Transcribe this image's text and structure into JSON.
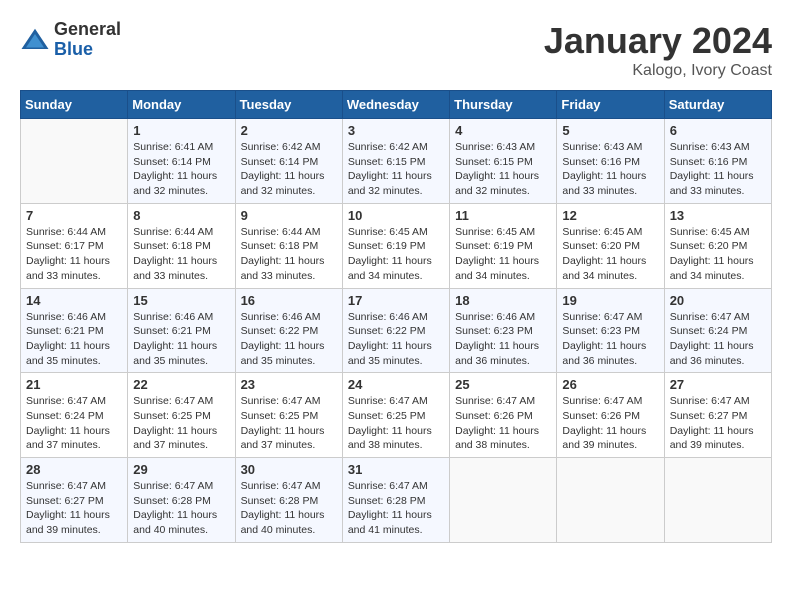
{
  "logo": {
    "general": "General",
    "blue": "Blue"
  },
  "title": "January 2024",
  "location": "Kalogo, Ivory Coast",
  "weekdays": [
    "Sunday",
    "Monday",
    "Tuesday",
    "Wednesday",
    "Thursday",
    "Friday",
    "Saturday"
  ],
  "weeks": [
    [
      {
        "day": "",
        "sunrise": "",
        "sunset": "",
        "daylight": ""
      },
      {
        "day": "1",
        "sunrise": "Sunrise: 6:41 AM",
        "sunset": "Sunset: 6:14 PM",
        "daylight": "Daylight: 11 hours and 32 minutes."
      },
      {
        "day": "2",
        "sunrise": "Sunrise: 6:42 AM",
        "sunset": "Sunset: 6:14 PM",
        "daylight": "Daylight: 11 hours and 32 minutes."
      },
      {
        "day": "3",
        "sunrise": "Sunrise: 6:42 AM",
        "sunset": "Sunset: 6:15 PM",
        "daylight": "Daylight: 11 hours and 32 minutes."
      },
      {
        "day": "4",
        "sunrise": "Sunrise: 6:43 AM",
        "sunset": "Sunset: 6:15 PM",
        "daylight": "Daylight: 11 hours and 32 minutes."
      },
      {
        "day": "5",
        "sunrise": "Sunrise: 6:43 AM",
        "sunset": "Sunset: 6:16 PM",
        "daylight": "Daylight: 11 hours and 33 minutes."
      },
      {
        "day": "6",
        "sunrise": "Sunrise: 6:43 AM",
        "sunset": "Sunset: 6:16 PM",
        "daylight": "Daylight: 11 hours and 33 minutes."
      }
    ],
    [
      {
        "day": "7",
        "sunrise": "Sunrise: 6:44 AM",
        "sunset": "Sunset: 6:17 PM",
        "daylight": "Daylight: 11 hours and 33 minutes."
      },
      {
        "day": "8",
        "sunrise": "Sunrise: 6:44 AM",
        "sunset": "Sunset: 6:18 PM",
        "daylight": "Daylight: 11 hours and 33 minutes."
      },
      {
        "day": "9",
        "sunrise": "Sunrise: 6:44 AM",
        "sunset": "Sunset: 6:18 PM",
        "daylight": "Daylight: 11 hours and 33 minutes."
      },
      {
        "day": "10",
        "sunrise": "Sunrise: 6:45 AM",
        "sunset": "Sunset: 6:19 PM",
        "daylight": "Daylight: 11 hours and 34 minutes."
      },
      {
        "day": "11",
        "sunrise": "Sunrise: 6:45 AM",
        "sunset": "Sunset: 6:19 PM",
        "daylight": "Daylight: 11 hours and 34 minutes."
      },
      {
        "day": "12",
        "sunrise": "Sunrise: 6:45 AM",
        "sunset": "Sunset: 6:20 PM",
        "daylight": "Daylight: 11 hours and 34 minutes."
      },
      {
        "day": "13",
        "sunrise": "Sunrise: 6:45 AM",
        "sunset": "Sunset: 6:20 PM",
        "daylight": "Daylight: 11 hours and 34 minutes."
      }
    ],
    [
      {
        "day": "14",
        "sunrise": "Sunrise: 6:46 AM",
        "sunset": "Sunset: 6:21 PM",
        "daylight": "Daylight: 11 hours and 35 minutes."
      },
      {
        "day": "15",
        "sunrise": "Sunrise: 6:46 AM",
        "sunset": "Sunset: 6:21 PM",
        "daylight": "Daylight: 11 hours and 35 minutes."
      },
      {
        "day": "16",
        "sunrise": "Sunrise: 6:46 AM",
        "sunset": "Sunset: 6:22 PM",
        "daylight": "Daylight: 11 hours and 35 minutes."
      },
      {
        "day": "17",
        "sunrise": "Sunrise: 6:46 AM",
        "sunset": "Sunset: 6:22 PM",
        "daylight": "Daylight: 11 hours and 35 minutes."
      },
      {
        "day": "18",
        "sunrise": "Sunrise: 6:46 AM",
        "sunset": "Sunset: 6:23 PM",
        "daylight": "Daylight: 11 hours and 36 minutes."
      },
      {
        "day": "19",
        "sunrise": "Sunrise: 6:47 AM",
        "sunset": "Sunset: 6:23 PM",
        "daylight": "Daylight: 11 hours and 36 minutes."
      },
      {
        "day": "20",
        "sunrise": "Sunrise: 6:47 AM",
        "sunset": "Sunset: 6:24 PM",
        "daylight": "Daylight: 11 hours and 36 minutes."
      }
    ],
    [
      {
        "day": "21",
        "sunrise": "Sunrise: 6:47 AM",
        "sunset": "Sunset: 6:24 PM",
        "daylight": "Daylight: 11 hours and 37 minutes."
      },
      {
        "day": "22",
        "sunrise": "Sunrise: 6:47 AM",
        "sunset": "Sunset: 6:25 PM",
        "daylight": "Daylight: 11 hours and 37 minutes."
      },
      {
        "day": "23",
        "sunrise": "Sunrise: 6:47 AM",
        "sunset": "Sunset: 6:25 PM",
        "daylight": "Daylight: 11 hours and 37 minutes."
      },
      {
        "day": "24",
        "sunrise": "Sunrise: 6:47 AM",
        "sunset": "Sunset: 6:25 PM",
        "daylight": "Daylight: 11 hours and 38 minutes."
      },
      {
        "day": "25",
        "sunrise": "Sunrise: 6:47 AM",
        "sunset": "Sunset: 6:26 PM",
        "daylight": "Daylight: 11 hours and 38 minutes."
      },
      {
        "day": "26",
        "sunrise": "Sunrise: 6:47 AM",
        "sunset": "Sunset: 6:26 PM",
        "daylight": "Daylight: 11 hours and 39 minutes."
      },
      {
        "day": "27",
        "sunrise": "Sunrise: 6:47 AM",
        "sunset": "Sunset: 6:27 PM",
        "daylight": "Daylight: 11 hours and 39 minutes."
      }
    ],
    [
      {
        "day": "28",
        "sunrise": "Sunrise: 6:47 AM",
        "sunset": "Sunset: 6:27 PM",
        "daylight": "Daylight: 11 hours and 39 minutes."
      },
      {
        "day": "29",
        "sunrise": "Sunrise: 6:47 AM",
        "sunset": "Sunset: 6:28 PM",
        "daylight": "Daylight: 11 hours and 40 minutes."
      },
      {
        "day": "30",
        "sunrise": "Sunrise: 6:47 AM",
        "sunset": "Sunset: 6:28 PM",
        "daylight": "Daylight: 11 hours and 40 minutes."
      },
      {
        "day": "31",
        "sunrise": "Sunrise: 6:47 AM",
        "sunset": "Sunset: 6:28 PM",
        "daylight": "Daylight: 11 hours and 41 minutes."
      },
      {
        "day": "",
        "sunrise": "",
        "sunset": "",
        "daylight": ""
      },
      {
        "day": "",
        "sunrise": "",
        "sunset": "",
        "daylight": ""
      },
      {
        "day": "",
        "sunrise": "",
        "sunset": "",
        "daylight": ""
      }
    ]
  ]
}
